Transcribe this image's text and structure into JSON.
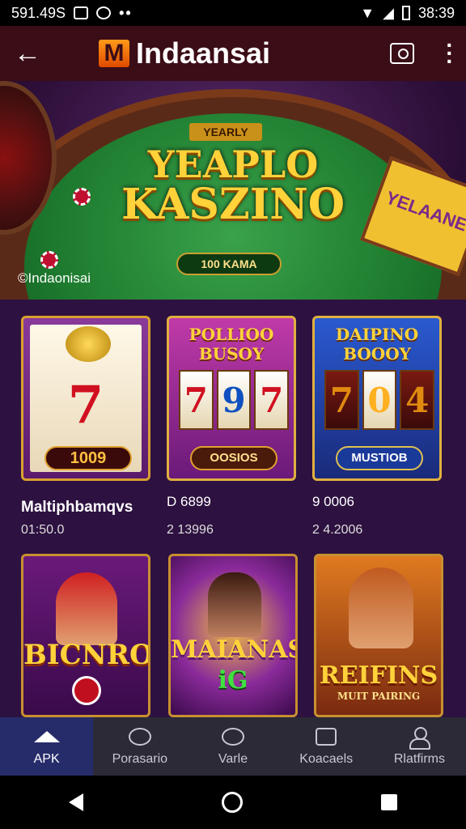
{
  "status_bar": {
    "left_text": "591.49S",
    "time": "38:39",
    "icons": [
      "image-icon",
      "b-badge-icon",
      "more-dots-icon",
      "wifi-icon",
      "signal-icon",
      "battery-icon"
    ]
  },
  "app_bar": {
    "brand_letter": "M",
    "brand_name": "Indaansai",
    "icons": [
      "back-arrow-icon",
      "search-icon",
      "more-vertical-icon"
    ]
  },
  "hero": {
    "title_top": "YEARLY",
    "title_line1": "YEAPLO",
    "title_line2": "KASZINO",
    "badge": "100 KAMA",
    "caption": "©Indaonisai",
    "side_sign": "YELAANE"
  },
  "games": [
    {
      "title": "",
      "pill": "1009",
      "reels": [
        "7"
      ],
      "big_glyph": "7"
    },
    {
      "title": "POLLIOO BUSOY",
      "pill": "OOSIOS",
      "reels": [
        "7",
        "9",
        "7"
      ]
    },
    {
      "title": "DAIPINO BOOOY",
      "pill": "MUSTIOB",
      "reels": [
        "7",
        "0",
        "4"
      ]
    },
    {
      "title": "BICNRO",
      "pill": "",
      "reels": []
    },
    {
      "title": "MAIANAS",
      "subtitle": "iG",
      "pill": "",
      "reels": []
    },
    {
      "title": "REIFINS",
      "subtitle": "MUIT PAIRING",
      "pill": "",
      "reels": []
    }
  ],
  "game_meta": [
    {
      "title": "Maltiphbamqvs",
      "sub": "01:50.0"
    },
    {
      "title": "D 6899",
      "sub": "2 13996"
    },
    {
      "title": "9 0006",
      "sub": "2 4.2006"
    }
  ],
  "bottom_nav": [
    {
      "label": "APK",
      "icon": "home-icon",
      "active": true
    },
    {
      "label": "Porasario",
      "icon": "chat-bubble-icon",
      "active": false
    },
    {
      "label": "Varle",
      "icon": "chat-bubble-icon",
      "active": false
    },
    {
      "label": "Koacaels",
      "icon": "tv-icon",
      "active": false
    },
    {
      "label": "Rlatfirms",
      "icon": "user-icon",
      "active": false
    }
  ],
  "colors": {
    "app_bar_bg": "#3b0d16",
    "brand_orange": "#ff9a1a",
    "felt_green": "#1d7a2e",
    "gold": "#ffd23a",
    "grid_bg": "#2d1140",
    "nav_active_bg": "#262c6a"
  }
}
